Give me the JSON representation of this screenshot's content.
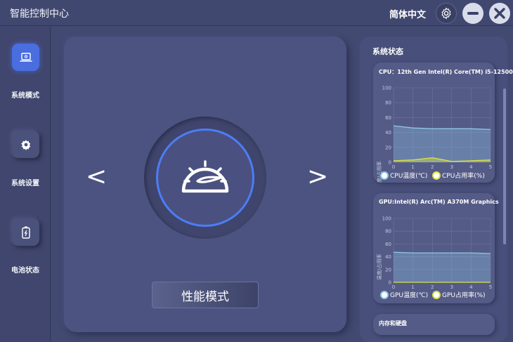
{
  "app": {
    "title": "智能控制中心",
    "language": "简体中文"
  },
  "sidebar": {
    "items": [
      {
        "label": "系统模式",
        "icon": "laptop-icon",
        "active": true
      },
      {
        "label": "系统设置",
        "icon": "gear-icon",
        "active": false
      },
      {
        "label": "电池状态",
        "icon": "battery-icon",
        "active": false
      }
    ]
  },
  "main": {
    "prev_arrow": "<",
    "next_arrow": ">",
    "mode_icon": "speedometer-icon",
    "mode_label": "性能模式"
  },
  "status": {
    "title": "系统状态",
    "cpu_card": {
      "title": "CPU：12th Gen Intel(R) Core(TM) i5-12500H",
      "ylabel": "温度/占用率",
      "legend_temp": "CPU温度(℃)",
      "legend_usage": "CPU占用率(%)"
    },
    "gpu_card": {
      "title": "GPU:Intel(R) Arc(TM) A370M Graphics",
      "ylabel": "温度/占用率",
      "legend_temp": "GPU温度(℃)",
      "legend_usage": "GPU占用率(%)"
    },
    "memory_card": {
      "title": "内存和硬盘"
    }
  },
  "colors": {
    "accent": "#4d7cf6",
    "temp_line": "#8fc6e8",
    "usage_line": "#d8e24a"
  },
  "chart_data": [
    {
      "type": "area",
      "x": [
        0,
        1,
        2,
        3,
        4,
        5
      ],
      "ylim": [
        0,
        100
      ],
      "xlim": [
        0,
        5
      ],
      "yticks": [
        0,
        20,
        40,
        60,
        80,
        100
      ],
      "xticks": [
        0,
        1,
        2,
        3,
        4,
        5
      ],
      "ylabel": "温度/占用率",
      "series": [
        {
          "name": "CPU温度(℃)",
          "values": [
            49,
            46,
            45,
            45,
            45,
            44
          ]
        },
        {
          "name": "CPU占用率(%)",
          "values": [
            2,
            3,
            6,
            1,
            2,
            3
          ]
        }
      ],
      "grid": true,
      "legend": "bottom"
    },
    {
      "type": "area",
      "x": [
        0,
        1,
        2,
        3,
        4,
        5
      ],
      "ylim": [
        0,
        100
      ],
      "xlim": [
        0,
        5
      ],
      "yticks": [
        0,
        20,
        40,
        60,
        80,
        100
      ],
      "xticks": [
        0,
        1,
        2,
        3,
        4,
        5
      ],
      "ylabel": "温度/占用率",
      "series": [
        {
          "name": "GPU温度(℃)",
          "values": [
            47,
            46,
            46,
            46,
            46,
            45
          ]
        },
        {
          "name": "GPU占用率(%)",
          "values": [
            0,
            0,
            0,
            0,
            0,
            0
          ]
        }
      ],
      "grid": true,
      "legend": "bottom"
    }
  ]
}
